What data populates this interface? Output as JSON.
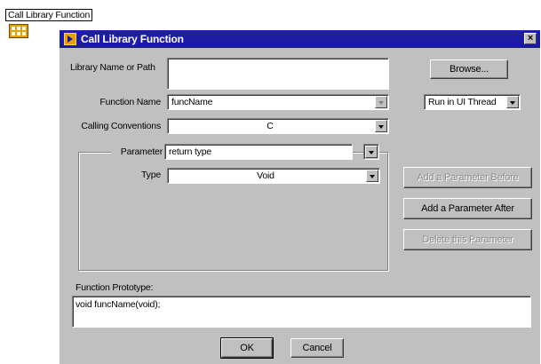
{
  "node": {
    "label": "Call Library Function"
  },
  "dialog": {
    "title": "Call Library Function",
    "close_glyph": "×",
    "library": {
      "label": "Library Name or Path",
      "value": ""
    },
    "browse_label": "Browse...",
    "function": {
      "label": "Function Name",
      "value": "funcName"
    },
    "thread": {
      "value": "Run in UI Thread"
    },
    "calling": {
      "label": "Calling Conventions",
      "value": "C"
    },
    "parameter": {
      "label": "Parameter",
      "value": "return type"
    },
    "type": {
      "label": "Type",
      "value": "Void"
    },
    "buttons": {
      "add_before": "Add a Parameter Before",
      "add_after": "Add a Parameter After",
      "delete": "Delete this Parameter"
    },
    "prototype": {
      "label": "Function Prototype:",
      "value": "void funcName(void);"
    },
    "ok_label": "OK",
    "cancel_label": "Cancel"
  },
  "colors": {
    "titlebar": "#1a1aa0",
    "face": "#c0c0c0",
    "icon": "#e8a000"
  }
}
